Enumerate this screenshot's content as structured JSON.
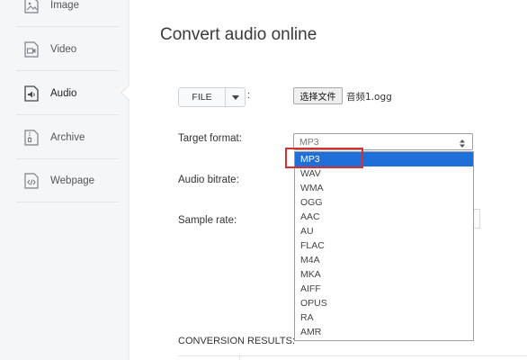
{
  "sidebar": {
    "items": [
      {
        "label": "Image",
        "icon": "image-icon"
      },
      {
        "label": "Video",
        "icon": "video-icon"
      },
      {
        "label": "Audio",
        "icon": "audio-icon",
        "active": true
      },
      {
        "label": "Archive",
        "icon": "archive-icon"
      },
      {
        "label": "Webpage",
        "icon": "webpage-icon"
      }
    ]
  },
  "main": {
    "title": "Convert audio online",
    "file_button": {
      "label": "FILE",
      "colon": ":"
    },
    "choose_file_label": "选择文件",
    "file_name": "音频1.ogg",
    "target_format_label": "Target format:",
    "audio_bitrate_label": "Audio bitrate:",
    "sample_rate_label": "Sample rate:",
    "target_format_value": "MP3",
    "format_options": [
      "MP3",
      "WAV",
      "WMA",
      "OGG",
      "AAC",
      "AU",
      "FLAC",
      "M4A",
      "MKA",
      "AIFF",
      "OPUS",
      "RA",
      "AMR"
    ],
    "selected_option": "MP3",
    "results_label": "CONVERSION RESULTS:"
  },
  "colors": {
    "selected_option_bg": "#1e6fd9",
    "highlight_border": "#d8302f",
    "sidebar_bg": "#f5f6f8"
  }
}
